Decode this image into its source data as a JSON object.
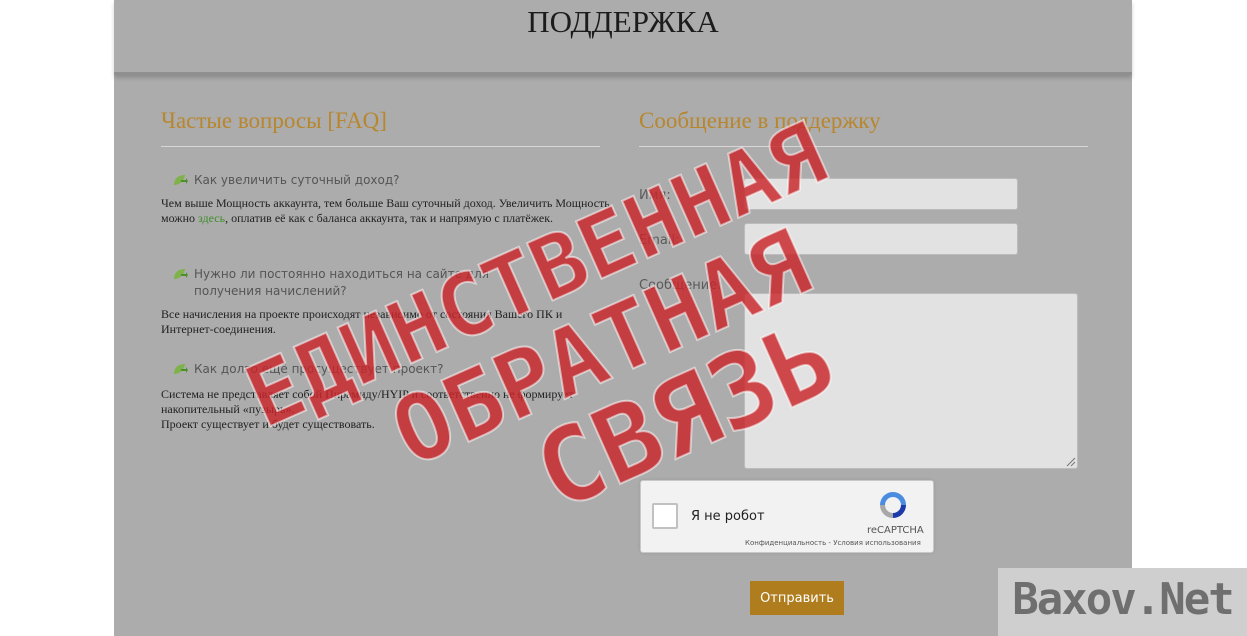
{
  "header": {
    "title": "ПОДДЕРЖКА"
  },
  "faq": {
    "title": "Частые вопросы [FAQ]",
    "items": [
      {
        "question": "Как увеличить суточный доход?",
        "answer_before_link": "Чем выше Мощность аккаунта, тем больше Ваш суточный доход. Увеличить Мощность можно ",
        "link": "здесь",
        "answer_after_link": ", оплатив её как с баланса аккаунта, так и напрямую с платёжек."
      },
      {
        "question": "Нужно ли постоянно находиться на сайте для получения начислений?",
        "answer": "Все начисления на проекте происходят независимо от состояния Вашего ПК и Интернет-соединения."
      },
      {
        "question": "Как долго ещё просуществует проект?",
        "answer_line1": "Система не представляет собой Пирамиду/HYIP и соответственно не формирует накопительный «пузырь».",
        "answer_line2": "Проект существует и будет существовать."
      }
    ]
  },
  "support_form": {
    "title": "Сообщение в поддержку",
    "name_label": "Имя:",
    "email_label": "Email:",
    "message_label": "Сообщение:",
    "name_value": "",
    "email_value": "",
    "message_value": "",
    "captcha": {
      "label": "Я не робот",
      "brand": "reCAPTCHA",
      "privacy": "Конфиденциальность",
      "separator": " - ",
      "terms": "Условия использования"
    },
    "submit_label": "Отправить"
  },
  "stamp": {
    "line1": "ЕДИНСТВЕННАЯ",
    "line2": "ОБРАТНАЯ",
    "line3": "СВЯЗЬ",
    "color": "#c8252a"
  },
  "watermark": {
    "text": "Baxov.Net"
  },
  "colors": {
    "panel_bg": "#acacac",
    "section_title": "#b8862d",
    "link": "#3f8e28",
    "button_bg": "#b07d1e"
  }
}
